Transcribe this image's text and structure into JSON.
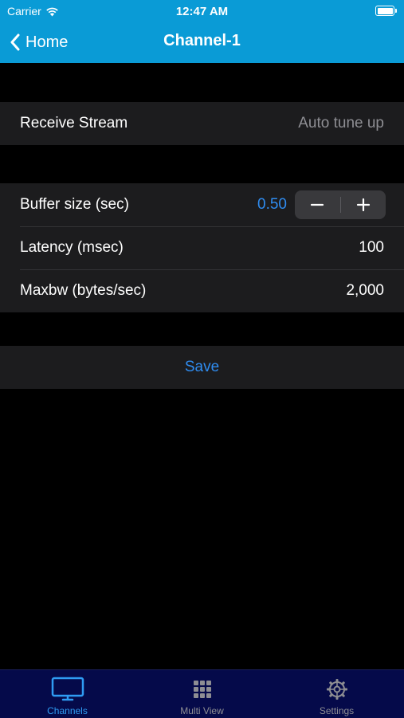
{
  "status_bar": {
    "carrier": "Carrier",
    "time": "12:47 AM"
  },
  "nav": {
    "back_label": "Home",
    "title": "Channel-1"
  },
  "stream_group": {
    "label": "Receive Stream",
    "value": "Auto tune up"
  },
  "params": {
    "buffer": {
      "label": "Buffer size (sec)",
      "value": "0.50",
      "decrement": "−",
      "increment": "+"
    },
    "latency": {
      "label": "Latency (msec)",
      "value": "100"
    },
    "maxbw": {
      "label": "Maxbw (bytes/sec)",
      "value": "2,000"
    }
  },
  "save": {
    "label": "Save"
  },
  "tabs": [
    {
      "label": "Channels",
      "icon": "monitor-icon",
      "active": true
    },
    {
      "label": "Multi View",
      "icon": "grid-icon",
      "active": false
    },
    {
      "label": "Settings",
      "icon": "gear-icon",
      "active": false
    }
  ],
  "colors": {
    "header": "#0a9bd6",
    "accent": "#2f8cf0",
    "tab_bar": "#050a4a",
    "cell": "#1c1c1e"
  }
}
